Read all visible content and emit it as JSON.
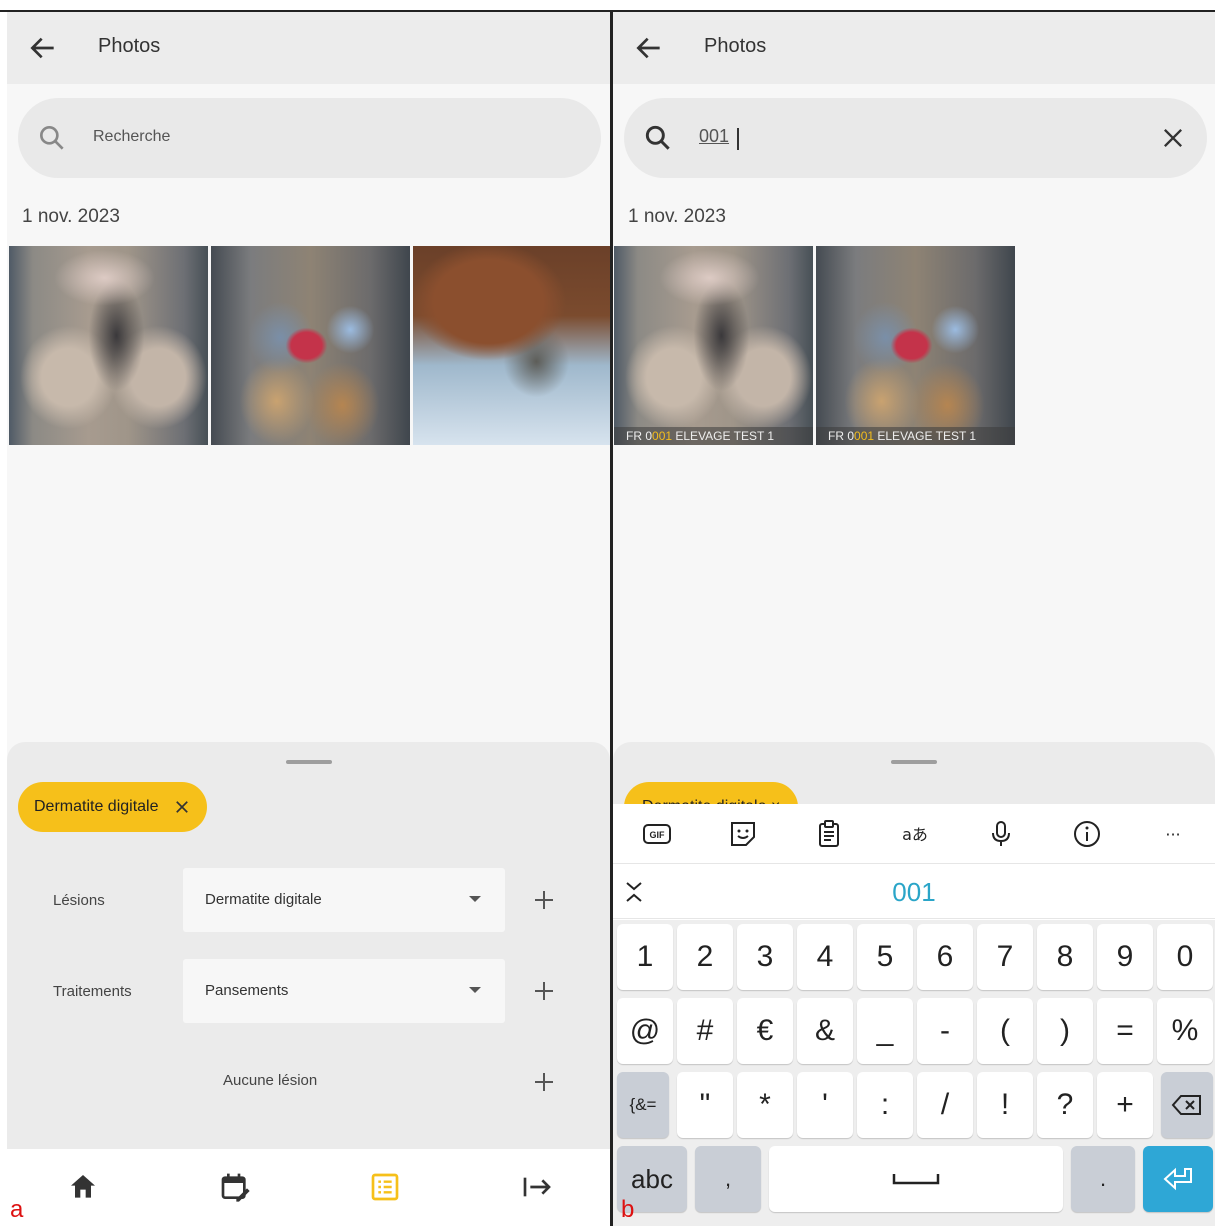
{
  "panel_a": {
    "corner_label": "a",
    "appbar": {
      "title": "Photos"
    },
    "search": {
      "placeholder": "Recherche"
    },
    "date": "1 nov. 2023",
    "thumbnails": [
      "hoof-lesion-photo-1",
      "hoof-lesion-photo-2",
      "hoof-lesion-photo-3"
    ],
    "sheet": {
      "chip_label": "Dermatite digitale",
      "rows": [
        {
          "label": "Lésions",
          "value": "Dermatite digitale"
        },
        {
          "label": "Traitements",
          "value": "Pansements"
        }
      ],
      "none_label": "Aucune lésion"
    },
    "bottom_nav": [
      "home-icon",
      "calendar-edit-icon",
      "list-icon",
      "logout-arrow-icon"
    ],
    "active_nav_color": "#f6c01a"
  },
  "panel_b": {
    "corner_label": "b",
    "appbar": {
      "title": "Photos"
    },
    "search": {
      "value": "001"
    },
    "date": "1 nov. 2023",
    "thumbnails": [
      {
        "caption_pre": "FR 0",
        "caption_hl": "001",
        "caption_post": " ELEVAGE TEST 1"
      },
      {
        "caption_pre": "FR 0",
        "caption_hl": "001",
        "caption_post": " ELEVAGE TEST 1"
      }
    ],
    "chip_partial": "Dermatite digitale ×",
    "keyboard": {
      "toolbar": [
        "gif-icon",
        "sticker-icon",
        "clipboard-icon",
        "translate-icon",
        "microphone-icon",
        "info-icon",
        "more-icon"
      ],
      "gif_label": "GIF",
      "translate_label": "aあ",
      "more_label": "···",
      "suggestion": "001",
      "row1": [
        "1",
        "2",
        "3",
        "4",
        "5",
        "6",
        "7",
        "8",
        "9",
        "0"
      ],
      "row2": [
        "@",
        "#",
        "€",
        "&",
        "_",
        "-",
        "(",
        ")",
        "=",
        "%"
      ],
      "row3_left": "{&=",
      "row3": [
        "\"",
        "*",
        "'",
        ":",
        "/",
        "!",
        "?",
        "+"
      ],
      "row4_left": "abc",
      "comma": ",",
      "period": "."
    },
    "accent_color": "#2aa5c8"
  }
}
